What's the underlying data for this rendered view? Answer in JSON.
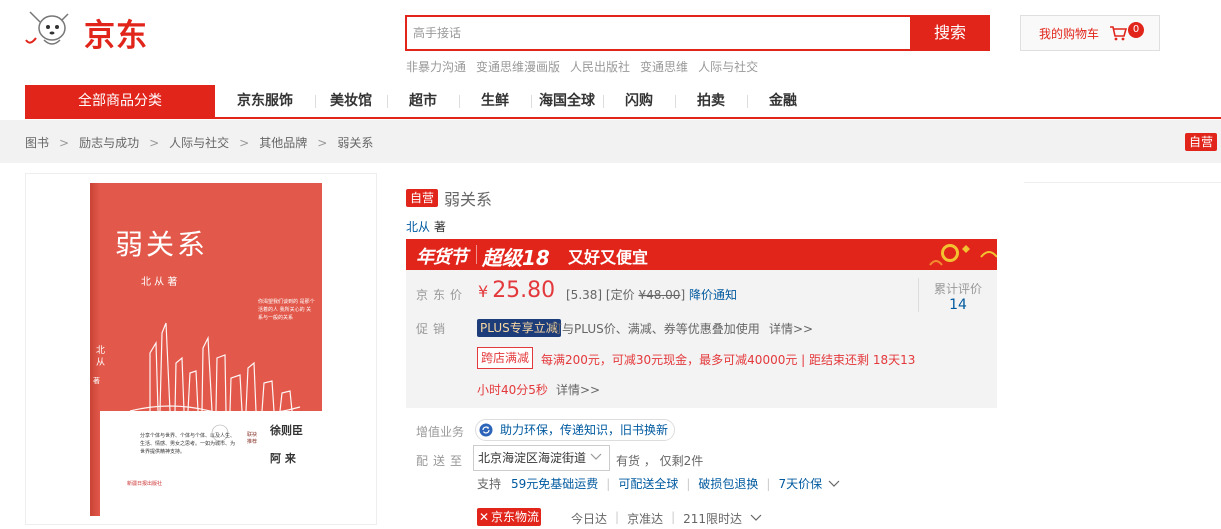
{
  "header": {
    "logo_text": "京东",
    "search_placeholder": "高手接话",
    "search_button": "搜索",
    "hotwords": [
      "非暴力沟通",
      "变通思维漫画版",
      "人民出版社",
      "变通思维",
      "人际与社交"
    ],
    "cart_label": "我的购物车",
    "cart_count": "0"
  },
  "nav": {
    "all_categories": "全部商品分类",
    "items": [
      "京东服饰",
      "美妆馆",
      "超市",
      "生鲜",
      "海国全球",
      "闪购",
      "拍卖",
      "金融"
    ]
  },
  "breadcrumb": {
    "items": [
      "图书",
      "励志与成功",
      "人际与社交",
      "其他品牌",
      "弱关系"
    ],
    "self_operated_tag": "自营"
  },
  "product": {
    "self_tag": "自营",
    "title": "弱关系",
    "author_name": "北从",
    "author_suffix": "著",
    "promo": {
      "festival": "年货节",
      "super": "超级18",
      "slogan": "又好又便宜"
    },
    "price": {
      "label": "京东价",
      "currency": "¥",
      "value": "25.80",
      "discount": "[5.38]",
      "list_label": "[定价",
      "list_price": "¥48.00",
      "list_close": "]",
      "notify": "降价通知"
    },
    "reviews": {
      "label": "累计评价",
      "count": "14"
    },
    "promotion": {
      "label": "促销",
      "plus_tag": "PLUS专享立减",
      "plus_text": "可与PLUS价、满减、券等优惠叠加使用",
      "plus_more": "详情>>",
      "cross_tag": "跨店满减",
      "cross_text": "每满200元，可减30元现金，最多可减40000元 | 距结束还剩 18天13",
      "cross_text2": "小时40分5秒",
      "cross_more": "详情>>"
    },
    "value_added": {
      "label": "增值业务",
      "service": "助力环保，传递知识，旧书换新"
    },
    "shipping": {
      "label": "配送至",
      "address": "北京海淀区海淀街道",
      "stock": "有货 ， 仅剩2件",
      "support_label": "支持",
      "support_items": [
        "59元免基础运费",
        "可配送全球",
        "破损包退换",
        "7天价保"
      ]
    },
    "logistics": {
      "logo": "京东物流",
      "items": [
        "今日达",
        "京准达",
        "211限时达"
      ]
    }
  },
  "book_cover": {
    "title": "弱关系",
    "author": "北 从 著",
    "blurb": "你渴望我们谈到的 是那个活着的人 我所关心的 关系与一般的关系",
    "recommender": "徐则臣",
    "recommender2": "阿 来",
    "recommend_tag": "联袂推荐",
    "spine_author": "北 从",
    "spine_suffix": "著",
    "desc": "分享个体与世界、个体与个体、以及人生、生活、情感、男女之思考。一如为城市、为世界提供精神支持。",
    "publisher": "新疆日报出版社"
  },
  "colors": {
    "brand_red": "#e1251b",
    "link_blue": "#005aa0",
    "price_red": "#e4393c",
    "cover_red": "#e2584a"
  }
}
